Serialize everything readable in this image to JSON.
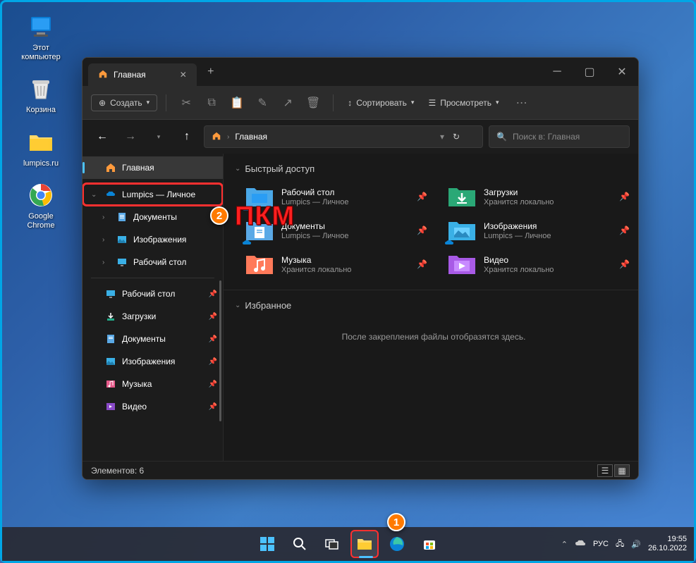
{
  "desktop": {
    "icons": [
      {
        "name": "this-pc",
        "label": "Этот\nкомпьютер"
      },
      {
        "name": "recycle-bin",
        "label": "Корзина"
      },
      {
        "name": "lumpics-folder",
        "label": "lumpics.ru"
      },
      {
        "name": "chrome",
        "label": "Google\nChrome"
      }
    ]
  },
  "explorer": {
    "tab": {
      "title": "Главная"
    },
    "toolbar": {
      "new": "Создать",
      "sort": "Сортировать",
      "view": "Просмотреть"
    },
    "address": {
      "location": "Главная",
      "search_placeholder": "Поиск в: Главная"
    },
    "sidebar": {
      "home": "Главная",
      "onedrive": "Lumpics — Личное",
      "onedrive_children": [
        "Документы",
        "Изображения",
        "Рабочий стол"
      ],
      "quick": [
        "Рабочий стол",
        "Загрузки",
        "Документы",
        "Изображения",
        "Музыка",
        "Видео"
      ]
    },
    "content": {
      "quick_access_header": "Быстрый доступ",
      "favorites_header": "Избранное",
      "favorites_empty": "После закрепления файлы отобразятся здесь.",
      "items": [
        {
          "name": "Рабочий стол",
          "sub": "Lumpics — Личное",
          "icon": "desktop",
          "cloud": true
        },
        {
          "name": "Загрузки",
          "sub": "Хранится локально",
          "icon": "downloads",
          "cloud": false
        },
        {
          "name": "Документы",
          "sub": "Lumpics — Личное",
          "icon": "documents",
          "cloud": true
        },
        {
          "name": "Изображения",
          "sub": "Lumpics — Личное",
          "icon": "pictures",
          "cloud": true
        },
        {
          "name": "Музыка",
          "sub": "Хранится локально",
          "icon": "music",
          "cloud": false
        },
        {
          "name": "Видео",
          "sub": "Хранится локально",
          "icon": "video",
          "cloud": false
        }
      ]
    },
    "status": {
      "items_text": "Элементов: 6"
    }
  },
  "taskbar": {
    "tray": {
      "lang": "РУС",
      "time": "19:55",
      "date": "26.10.2022"
    }
  },
  "annotations": {
    "rmb_text": "ПКМ"
  }
}
